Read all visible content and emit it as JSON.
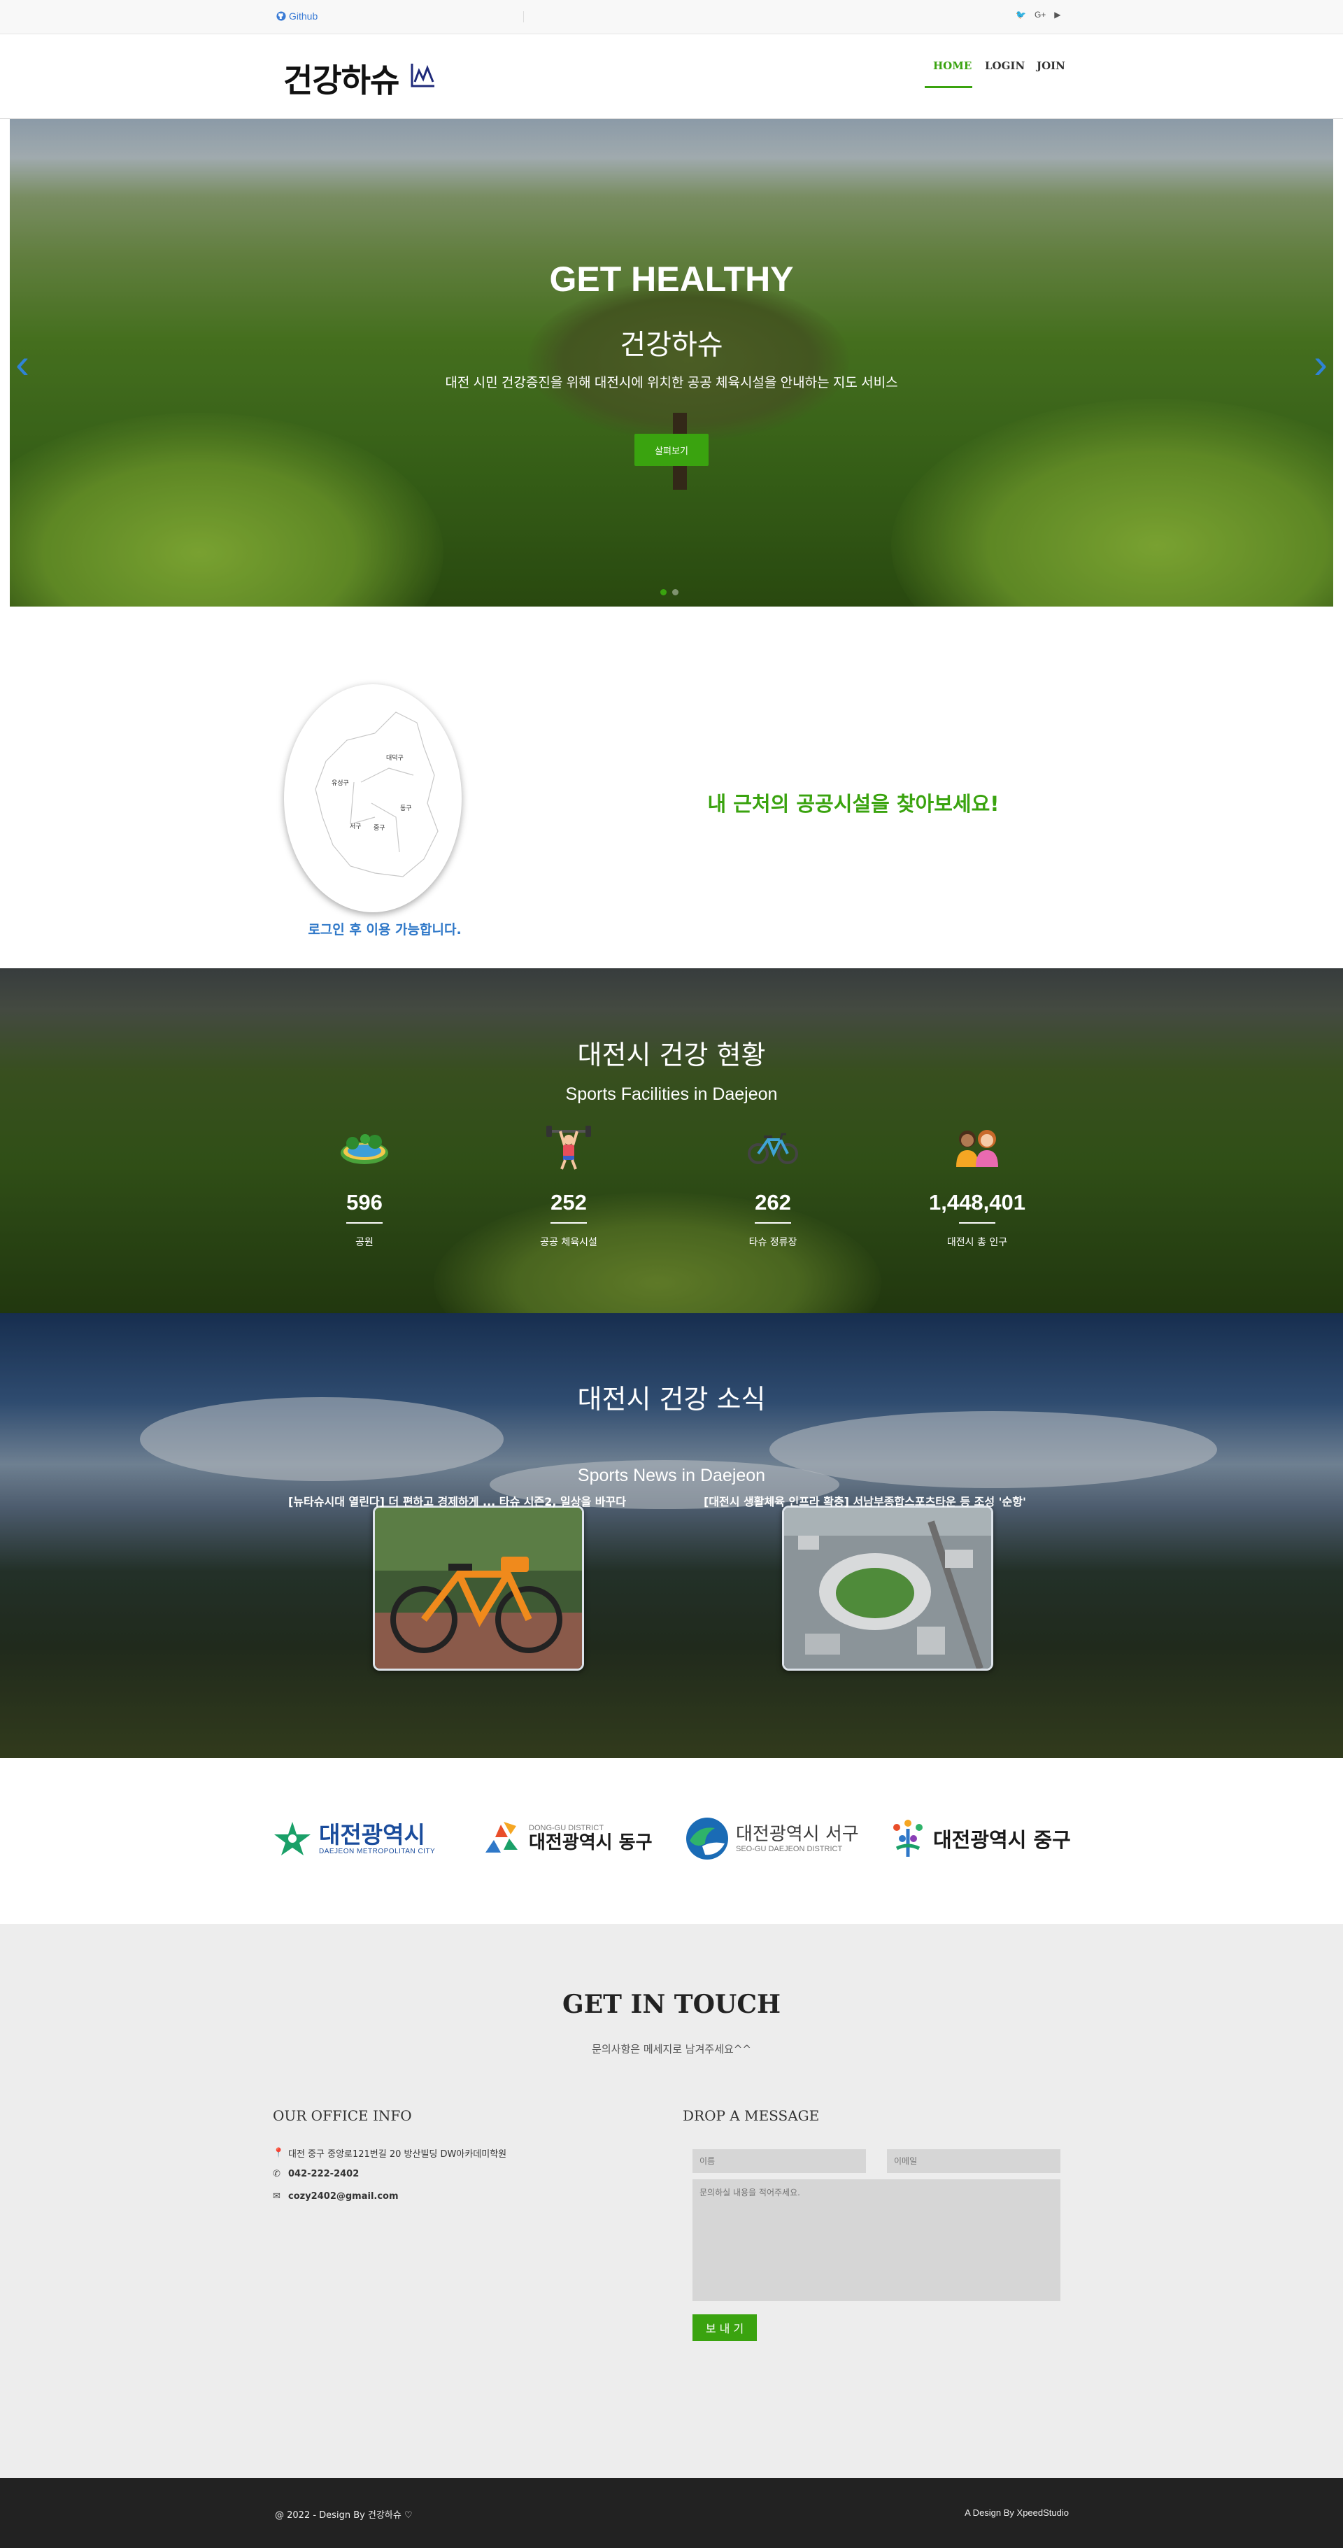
{
  "topbar": {
    "github_label": "Github",
    "social": [
      "twitter-icon",
      "google-plus-icon",
      "youtube-icon"
    ],
    "social_glyphs": [
      "🐦",
      "G+",
      "▶"
    ]
  },
  "header": {
    "logo_text": "건강하슈",
    "nav": [
      {
        "label": "HOME",
        "active": true
      },
      {
        "label": "LOGIN",
        "active": false
      },
      {
        "label": "JOIN",
        "active": false
      }
    ]
  },
  "hero": {
    "title": "GET HEALTHY",
    "subtitle": "건강하슈",
    "description": "대전 시민 건강증진을 위해 대전시에 위치한 공공 체육시설을 안내하는 지도 서비스",
    "button_label": "살펴보기",
    "prev_arrow": "‹",
    "next_arrow": "›"
  },
  "map_section": {
    "districts": [
      "대덕구",
      "유성구",
      "동구",
      "서구",
      "중구"
    ],
    "login_notice": "로그인 후 이용 가능합니다.",
    "headline": "내 근처의 공공시설을 찾아보세요!"
  },
  "stats": {
    "title": "대전시 건강 현황",
    "subtitle": "Sports Facilities in Daejeon",
    "items": [
      {
        "icon": "park-icon",
        "value": "596",
        "label": "공원"
      },
      {
        "icon": "weightlifter-icon",
        "value": "252",
        "label": "공공 체육시설"
      },
      {
        "icon": "bicycle-icon",
        "value": "262",
        "label": "타슈 정류장"
      },
      {
        "icon": "people-icon",
        "value": "1,448,401",
        "label": "대전시 총 인구"
      }
    ]
  },
  "news": {
    "title": "대전시 건강 소식",
    "subtitle": "Sports News in Daejeon",
    "items": [
      {
        "image": "orange-bicycle-image",
        "caption": "[뉴타슈시대 열린다] 더 편하고 경제하게 ... 타슈 시즌2, 일상을 바꾸다"
      },
      {
        "image": "stadium-aerial-image",
        "caption": "[대전시 생활체육 인프라 확충] 서남부종합스포츠타운 등 조성 '순항'"
      }
    ]
  },
  "partners": [
    {
      "name": "대전광역시",
      "sub": "DAEJEON METROPOLITAN CITY",
      "color": "#1a4c9c"
    },
    {
      "name": "대전광역시 동구",
      "sub": "DONG-GU DISTRICT",
      "color": "#1a1a1a"
    },
    {
      "name": "대전광역시 서구",
      "sub": "SEO-GU DAEJEON DISTRICT",
      "color": "#3a3a3a"
    },
    {
      "name": "대전광역시 중구",
      "sub": "",
      "color": "#1a1a1a"
    }
  ],
  "contact": {
    "title": "GET IN TOUCH",
    "subtitle": "문의사항은 메세지로 남겨주세요^^",
    "office_heading": "OUR OFFICE INFO",
    "message_heading": "DROP A MESSAGE",
    "address": "대전 중구 중앙로121번길 20 방산빌딩 DW아카데미학원",
    "phone": "042-222-2402",
    "email": "cozy2402@gmail.com",
    "name_placeholder": "이름",
    "email_placeholder": "이메일",
    "message_placeholder": "문의하실 내용을 적어주세요.",
    "send_label": "보 내 기"
  },
  "footer": {
    "left": "@ 2022 - Design By 건강하슈 ♡",
    "right": "A Design By XpeedStudio"
  }
}
